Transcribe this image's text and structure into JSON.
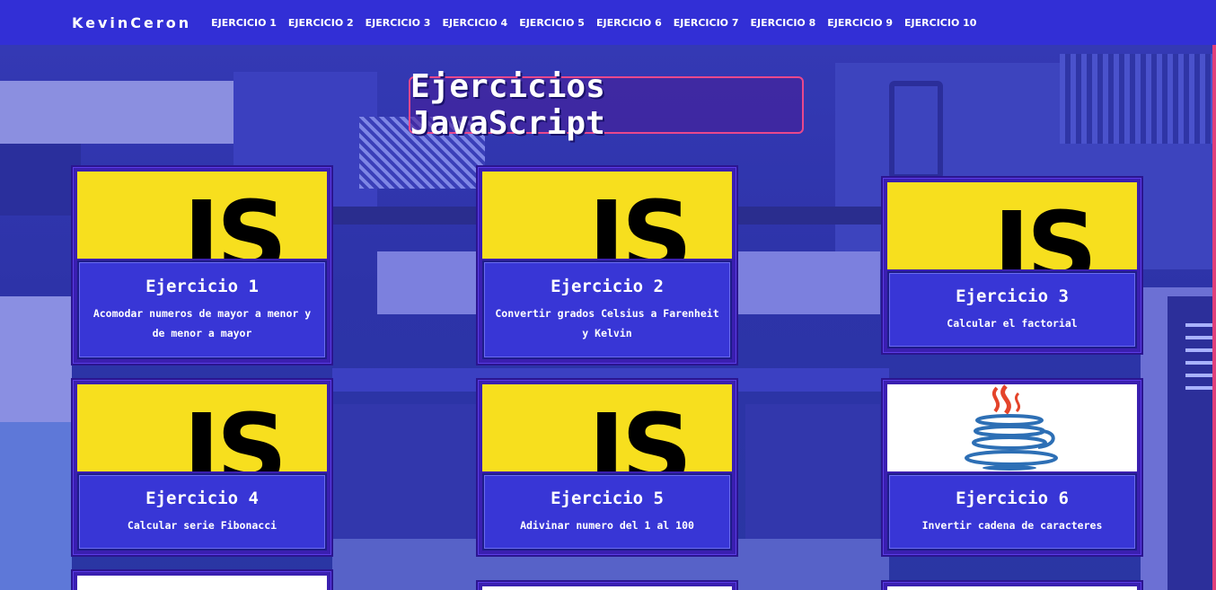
{
  "navbar": {
    "brand": "KevinCeron",
    "links": [
      "EJERCICIO 1",
      "EJERCICIO 2",
      "EJERCICIO 3",
      "EJERCICIO 4",
      "EJERCICIO 5",
      "EJERCICIO 6",
      "EJERCICIO 7",
      "EJERCICIO 8",
      "EJERCICIO 9",
      "EJERCICIO 10"
    ]
  },
  "page": {
    "title": "Ejercicios JavaScript"
  },
  "cards": [
    {
      "image": "js-logo",
      "image_text": "JS",
      "title": "Ejercicio 1",
      "desc": "Acomodar numeros de mayor a menor y de menor a mayor"
    },
    {
      "image": "js-logo",
      "image_text": "JS",
      "title": "Ejercicio 2",
      "desc": "Convertir grados Celsius a Farenheit y Kelvin"
    },
    {
      "image": "js-logo",
      "image_text": "JS",
      "title": "Ejercicio 3",
      "desc": "Calcular el factorial"
    },
    {
      "image": "js-logo",
      "image_text": "JS",
      "title": "Ejercicio 4",
      "desc": "Calcular serie Fibonacci"
    },
    {
      "image": "js-logo",
      "image_text": "JS",
      "title": "Ejercicio 5",
      "desc": "Adivinar numero del 1 al 100"
    },
    {
      "image": "java-logo",
      "title": "Ejercicio 6",
      "desc": "Invertir cadena de caracteres"
    }
  ],
  "colors": {
    "navbar": "#322fd6",
    "card_body": "#3836d6",
    "js_yellow": "#f7df1e",
    "title_border": "#e8488c"
  }
}
